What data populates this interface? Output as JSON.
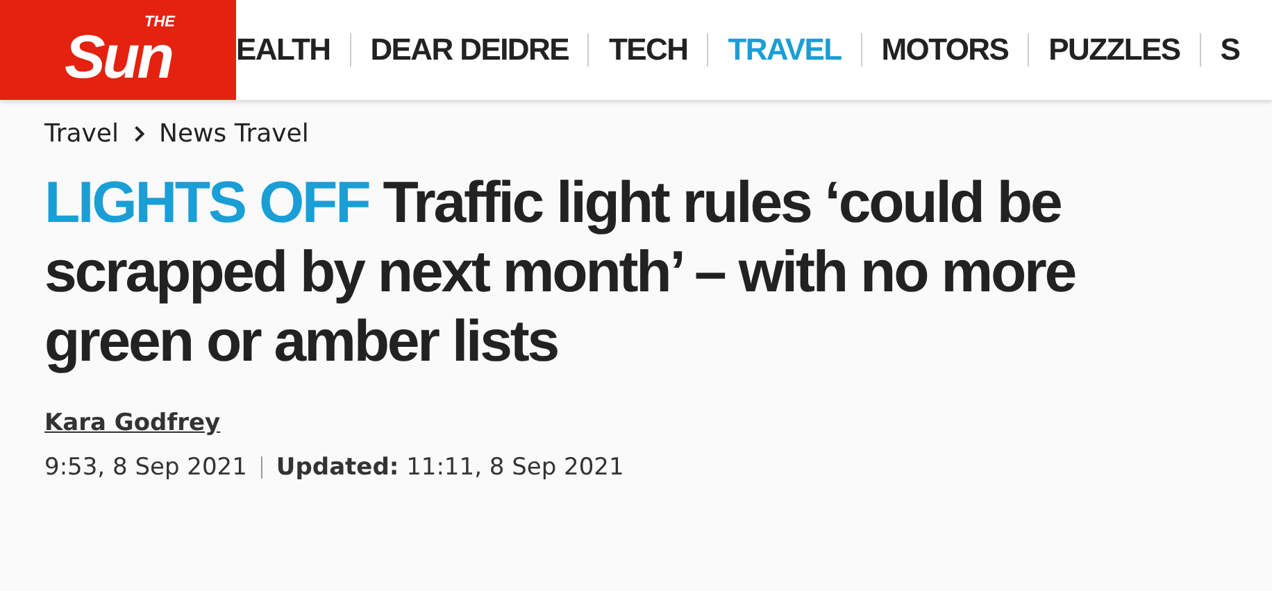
{
  "logo": {
    "small": "THE",
    "big": "Sun"
  },
  "nav": [
    {
      "label": "EALTH",
      "selected": false
    },
    {
      "label": "DEAR DEIDRE",
      "selected": false
    },
    {
      "label": "TECH",
      "selected": false
    },
    {
      "label": "TRAVEL",
      "selected": true
    },
    {
      "label": "MOTORS",
      "selected": false
    },
    {
      "label": "PUZZLES",
      "selected": false
    },
    {
      "label": "S",
      "selected": false
    }
  ],
  "breadcrumb": [
    "Travel",
    "News Travel"
  ],
  "headline": {
    "kicker": "LIGHTS OFF",
    "title": "Traffic light rules ‘could be scrapped by next month’ – with no more green or amber lists"
  },
  "author": "Kara Godfrey",
  "published": "9:53, 8 Sep 2021",
  "updated": "**Updated:** 11:11, 8 Sep 2021"
}
